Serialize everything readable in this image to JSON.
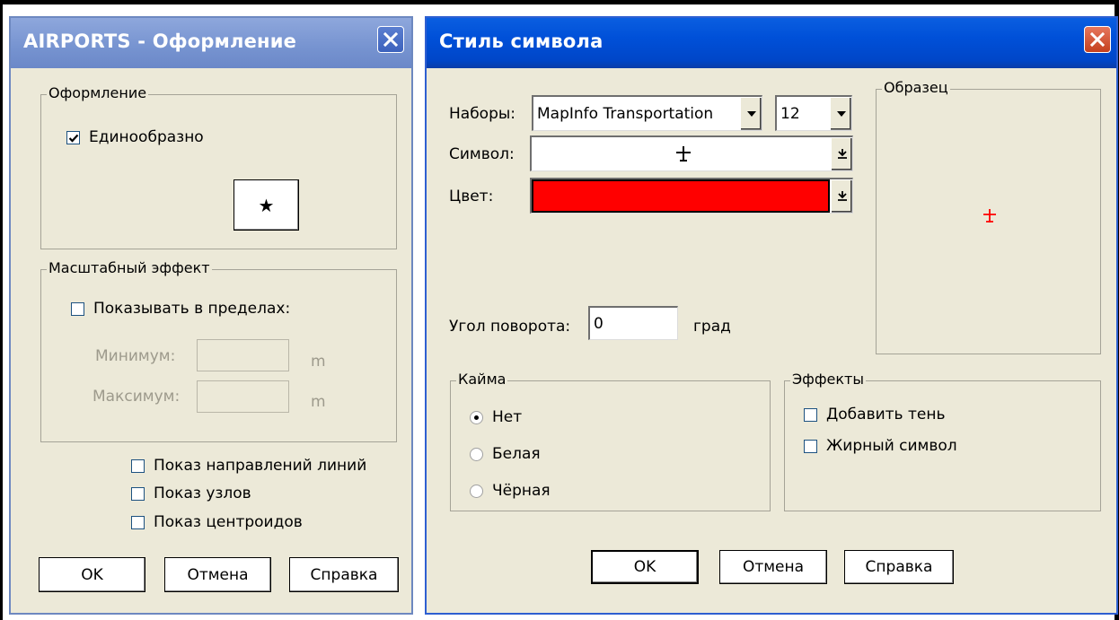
{
  "layer_dialog": {
    "title": "AIRPORTS - Оформление",
    "style_group": {
      "label": "Оформление",
      "uniform_label": "Единообразно",
      "uniform_checked": true,
      "symbol_button_glyph": "★"
    },
    "zoom_group": {
      "label": "Масштабный эффект",
      "show_within_label": "Показывать в пределах:",
      "show_within_checked": false,
      "min_label": "Минимум:",
      "min_value": "",
      "min_unit": "m",
      "max_label": "Максимум:",
      "max_value": "",
      "max_unit": "m"
    },
    "options": [
      {
        "label": "Показ направлений линий",
        "checked": false
      },
      {
        "label": "Показ узлов",
        "checked": false
      },
      {
        "label": "Показ центроидов",
        "checked": false
      }
    ],
    "buttons": {
      "ok": "OK",
      "cancel": "Отмена",
      "help": "Справка"
    }
  },
  "symbol_dialog": {
    "title": "Стиль символа",
    "font_set_label": "Наборы:",
    "font_set_value": "MapInfo Transportation",
    "size_value": "12",
    "symbol_label": "Символ:",
    "symbol_glyph": "✈",
    "color_label": "Цвет:",
    "color_value": "#ff0000",
    "sample_label": "Образец",
    "rotation_label": "Угол поворота:",
    "rotation_value": "0",
    "rotation_unit": "град",
    "border_group": {
      "label": "Кайма",
      "options": [
        {
          "label": "Нет",
          "selected": true
        },
        {
          "label": "Белая",
          "selected": false
        },
        {
          "label": "Чёрная",
          "selected": false
        }
      ]
    },
    "effects_group": {
      "label": "Эффекты",
      "options": [
        {
          "label": "Добавить тень",
          "checked": false
        },
        {
          "label": "Жирный символ",
          "checked": false
        }
      ]
    },
    "buttons": {
      "ok": "OK",
      "cancel": "Отмена",
      "help": "Справка"
    }
  },
  "colors": {
    "active_titlebar": "#0050d8",
    "inactive_titlebar": "#7693d0",
    "dialog_bg": "#ece9d8",
    "symbol_color": "#ff0000"
  }
}
